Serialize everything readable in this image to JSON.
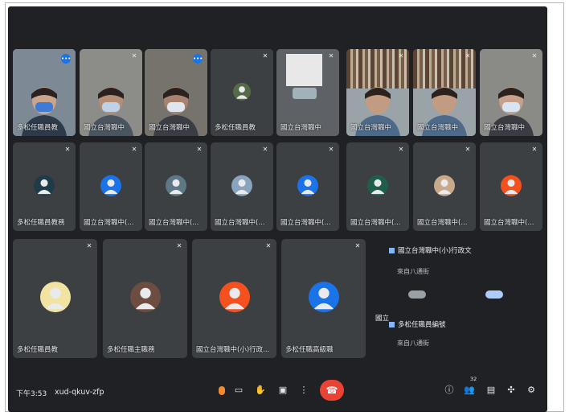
{
  "meeting": {
    "time": "下午3:53",
    "code": "xud-qkuv-zfp"
  },
  "tiles_row1": [
    {
      "name": "多松任職員教",
      "kind": "video"
    },
    {
      "name": "國立台灣職中",
      "kind": "video"
    },
    {
      "name": "國立台灣職中",
      "kind": "video"
    },
    {
      "name": "多松任職員教",
      "kind": "avatar"
    },
    {
      "name": "國立台灣職中",
      "kind": "video"
    },
    {
      "name": "國立台灣職中",
      "kind": "video"
    },
    {
      "name": "國立台灣職中",
      "kind": "video"
    },
    {
      "name": "國立台灣職中",
      "kind": "video"
    }
  ],
  "tiles_row2": [
    {
      "name": "多松任職員教務",
      "avatar_color": "#1f3b4a"
    },
    {
      "name": "國立台灣職中(...",
      "avatar_color": "#1a73e8"
    },
    {
      "name": "國立台灣職中(...",
      "avatar_color": "#5f7886"
    },
    {
      "name": "國立台灣職中(...",
      "avatar_color": "#8aa4bd"
    },
    {
      "name": "國立台灣職中(...",
      "avatar_color": "#1a73e8"
    },
    {
      "name": "國立台灣職中(...",
      "avatar_color": "#1e5e4a"
    },
    {
      "name": "國立台灣職中(...",
      "avatar_color": "#c8a989"
    },
    {
      "name": "國立台灣職中(...",
      "avatar_color": "#f4511e"
    }
  ],
  "tiles_row3": [
    {
      "name": "多松任職員教",
      "avatar_color": "#f2e3a2"
    },
    {
      "name": "多松任職主職務",
      "avatar_color": "#6d4c41"
    },
    {
      "name": "國立台灣職中(小)行政...",
      "avatar_color": "#f4511e"
    },
    {
      "name": "多松任職高級職",
      "avatar_color": "#1a73e8"
    }
  ],
  "panel": {
    "entry1_name": "國立台灣職中(小)行政文",
    "entry1_sub": "來自八通街",
    "entry2_name": "多松任職員編號",
    "entry2_sub": "來自八通街",
    "left_stub": "國立"
  },
  "controls": {
    "chat_badge": "32",
    "icons": [
      "mic-icon",
      "camera-icon",
      "raise-hand-icon",
      "present-icon",
      "more-icon",
      "end-call-icon",
      "info-icon",
      "people-icon",
      "chat-icon",
      "activities-icon",
      "host-controls-icon"
    ]
  }
}
